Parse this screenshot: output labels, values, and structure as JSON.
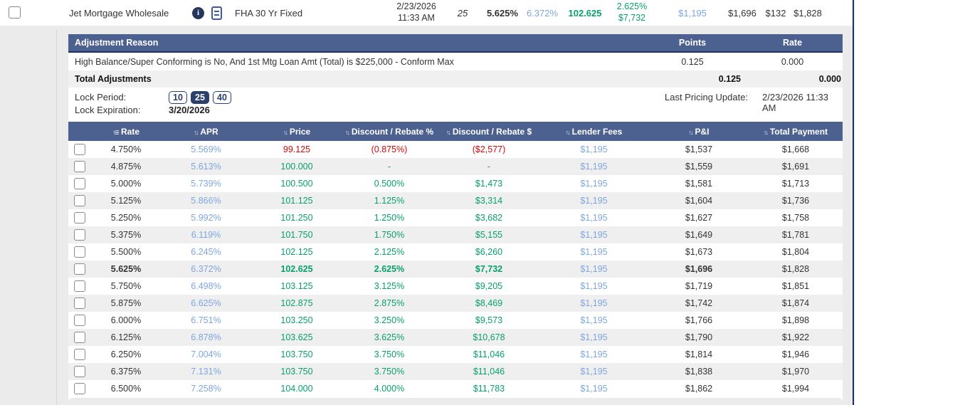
{
  "colors": {
    "header_blue": "#4d6191",
    "navy": "#1c2f5e",
    "green": "#07a06e",
    "red": "#d10a0a",
    "link_blue": "#7ea6e0",
    "row_alt_gray": "#efefef",
    "page_gray": "#ebebeb"
  },
  "top_row": {
    "lender": "Jet Mortgage Wholesale",
    "info_icon": "i",
    "program": "FHA 30 Yr Fixed",
    "date_line1": "2/23/2026",
    "date_line2": "11:33 AM",
    "lock_days": "25",
    "rate": "5.625%",
    "apr": "6.372%",
    "price": "102.625",
    "rebate_pct": "2.625%",
    "rebate_amt": "$7,732",
    "lender_fees": "$1,195",
    "pi": "$1,696",
    "mi": "$132",
    "total_payment": "$1,828"
  },
  "adjustments": {
    "header": {
      "reason": "Adjustment Reason",
      "points": "Points",
      "rate": "Rate"
    },
    "rows": [
      {
        "reason": "High Balance/Super Conforming is No, And 1st Mtg Loan Amt (Total) is $225,000 - Conform Max",
        "points": "0.125",
        "rate": "0.000"
      }
    ],
    "total_label": "Total Adjustments",
    "total_points": "0.125",
    "total_rate": "0.000"
  },
  "lock": {
    "period_label": "Lock Period:",
    "options": [
      "10",
      "25",
      "40"
    ],
    "selected": "25",
    "expiration_label": "Lock Expiration:",
    "expiration": "3/20/2026",
    "last_update_label": "Last Pricing Update:",
    "last_update": "2/23/2026 11:33 AM"
  },
  "rate_table": {
    "columns": [
      "Rate",
      "APR",
      "Price",
      "Discount / Rebate %",
      "Discount / Rebate $",
      "Lender Fees",
      "P&I",
      "Total Payment"
    ],
    "sorted_column": "Rate",
    "rows": [
      {
        "rate": "4.750%",
        "apr": "5.569%",
        "price": "99.125",
        "disc_pct": "(0.875%)",
        "disc_amt": "($2,577)",
        "fees": "$1,195",
        "pi": "$1,537",
        "total": "$1,668",
        "negative": true,
        "selected": false
      },
      {
        "rate": "4.875%",
        "apr": "5.613%",
        "price": "100.000",
        "disc_pct": "-",
        "disc_amt": "-",
        "fees": "$1,195",
        "pi": "$1,559",
        "total": "$1,691",
        "negative": false,
        "selected": false
      },
      {
        "rate": "5.000%",
        "apr": "5.739%",
        "price": "100.500",
        "disc_pct": "0.500%",
        "disc_amt": "$1,473",
        "fees": "$1,195",
        "pi": "$1,581",
        "total": "$1,713",
        "negative": false,
        "selected": false
      },
      {
        "rate": "5.125%",
        "apr": "5.866%",
        "price": "101.125",
        "disc_pct": "1.125%",
        "disc_amt": "$3,314",
        "fees": "$1,195",
        "pi": "$1,604",
        "total": "$1,736",
        "negative": false,
        "selected": false
      },
      {
        "rate": "5.250%",
        "apr": "5.992%",
        "price": "101.250",
        "disc_pct": "1.250%",
        "disc_amt": "$3,682",
        "fees": "$1,195",
        "pi": "$1,627",
        "total": "$1,758",
        "negative": false,
        "selected": false
      },
      {
        "rate": "5.375%",
        "apr": "6.119%",
        "price": "101.750",
        "disc_pct": "1.750%",
        "disc_amt": "$5,155",
        "fees": "$1,195",
        "pi": "$1,649",
        "total": "$1,781",
        "negative": false,
        "selected": false
      },
      {
        "rate": "5.500%",
        "apr": "6.245%",
        "price": "102.125",
        "disc_pct": "2.125%",
        "disc_amt": "$6,260",
        "fees": "$1,195",
        "pi": "$1,673",
        "total": "$1,804",
        "negative": false,
        "selected": false
      },
      {
        "rate": "5.625%",
        "apr": "6.372%",
        "price": "102.625",
        "disc_pct": "2.625%",
        "disc_amt": "$7,732",
        "fees": "$1,195",
        "pi": "$1,696",
        "total": "$1,828",
        "negative": false,
        "selected": true
      },
      {
        "rate": "5.750%",
        "apr": "6.498%",
        "price": "103.125",
        "disc_pct": "3.125%",
        "disc_amt": "$9,205",
        "fees": "$1,195",
        "pi": "$1,719",
        "total": "$1,851",
        "negative": false,
        "selected": false
      },
      {
        "rate": "5.875%",
        "apr": "6.625%",
        "price": "102.875",
        "disc_pct": "2.875%",
        "disc_amt": "$8,469",
        "fees": "$1,195",
        "pi": "$1,742",
        "total": "$1,874",
        "negative": false,
        "selected": false
      },
      {
        "rate": "6.000%",
        "apr": "6.751%",
        "price": "103.250",
        "disc_pct": "3.250%",
        "disc_amt": "$9,573",
        "fees": "$1,195",
        "pi": "$1,766",
        "total": "$1,898",
        "negative": false,
        "selected": false
      },
      {
        "rate": "6.125%",
        "apr": "6.878%",
        "price": "103.625",
        "disc_pct": "3.625%",
        "disc_amt": "$10,678",
        "fees": "$1,195",
        "pi": "$1,790",
        "total": "$1,922",
        "negative": false,
        "selected": false
      },
      {
        "rate": "6.250%",
        "apr": "7.004%",
        "price": "103.750",
        "disc_pct": "3.750%",
        "disc_amt": "$11,046",
        "fees": "$1,195",
        "pi": "$1,814",
        "total": "$1,946",
        "negative": false,
        "selected": false
      },
      {
        "rate": "6.375%",
        "apr": "7.131%",
        "price": "103.750",
        "disc_pct": "3.750%",
        "disc_amt": "$11,046",
        "fees": "$1,195",
        "pi": "$1,838",
        "total": "$1,970",
        "negative": false,
        "selected": false
      },
      {
        "rate": "6.500%",
        "apr": "7.258%",
        "price": "104.000",
        "disc_pct": "4.000%",
        "disc_amt": "$11,783",
        "fees": "$1,195",
        "pi": "$1,862",
        "total": "$1,994",
        "negative": false,
        "selected": false
      }
    ]
  }
}
